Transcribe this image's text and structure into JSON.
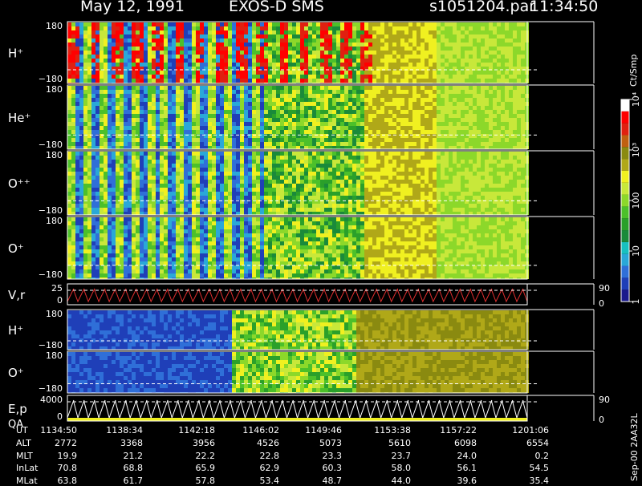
{
  "title": {
    "date": "May 12, 1991",
    "instrument": "EXOS-D SMS",
    "file": "s1051204.par",
    "time": "11:34:50"
  },
  "colorbar": {
    "unit": "Ct/Smp",
    "ticks": [
      {
        "label": "10⁴",
        "value": 10000
      },
      {
        "label": "10³",
        "value": 1000
      },
      {
        "label": "100",
        "value": 100
      },
      {
        "label": "10",
        "value": 10
      },
      {
        "label": "1",
        "value": 1
      }
    ],
    "colors": [
      "#1a1a8c",
      "#1f3fb8",
      "#2f6fd8",
      "#2aa8d8",
      "#18c0c0",
      "#1a8a3a",
      "#2aa02a",
      "#4cc02a",
      "#8cd82a",
      "#c8e83a",
      "#f0f020",
      "#b0a818",
      "#8a8a10",
      "#c06010",
      "#e02010",
      "#ff0000",
      "#ffffff"
    ]
  },
  "footer_stamp": "Sep-00 2AA32L",
  "chart_data": {
    "type": "heatmap",
    "x_label": "UT",
    "x_ticks": [
      "1134:50",
      "1138:34",
      "1142:18",
      "1146:02",
      "1149:46",
      "1153:38",
      "1157:22",
      "1201:06"
    ],
    "panels": [
      {
        "label": "H⁺",
        "ymax": "180",
        "ymin": "−180"
      },
      {
        "label": "He⁺",
        "ymax": "180",
        "ymin": "−180"
      },
      {
        "label": "O⁺⁺",
        "ymax": "180",
        "ymin": "−180"
      },
      {
        "label": "O⁺",
        "ymax": "180",
        "ymin": "−180"
      },
      {
        "label": "V,r",
        "ymax": "25",
        "ymin": "0",
        "right_top": "90",
        "right_bottom": "0"
      },
      {
        "label": "H⁺",
        "ymax": "180",
        "ymin": "−180"
      },
      {
        "label": "O⁺",
        "ymax": "180",
        "ymin": "−180"
      },
      {
        "label": "E,p",
        "label2": "QA",
        "ymax": "4000",
        "ymin": "0",
        "right_top": "90",
        "right_bottom": "0"
      }
    ],
    "ephemeris": [
      {
        "name": "ALT",
        "values": [
          "2772",
          "3368",
          "3956",
          "4526",
          "5073",
          "5610",
          "6098",
          "6554"
        ]
      },
      {
        "name": "MLT",
        "values": [
          "19.9",
          "21.2",
          "22.2",
          "22.8",
          "23.3",
          "23.7",
          "24.0",
          "0.2"
        ]
      },
      {
        "name": "InLat",
        "values": [
          "70.8",
          "68.8",
          "65.9",
          "62.9",
          "60.3",
          "58.0",
          "56.1",
          "54.5"
        ]
      },
      {
        "name": "MLat",
        "values": [
          "63.8",
          "61.7",
          "57.8",
          "53.4",
          "48.7",
          "44.0",
          "39.6",
          "35.4"
        ]
      }
    ]
  }
}
